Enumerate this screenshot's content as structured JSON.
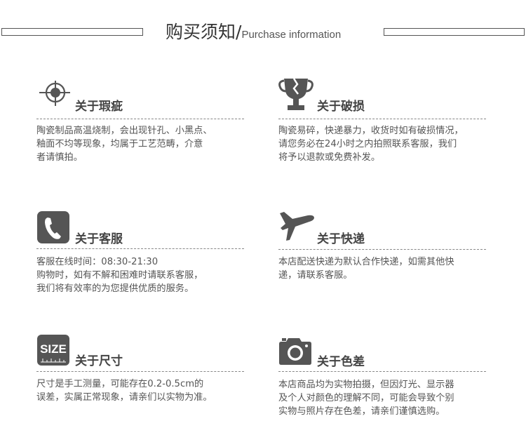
{
  "header": {
    "title_zh": "购买须知",
    "separator": "/",
    "title_en": "Purchase information"
  },
  "sections": [
    {
      "icon": "crosshair-icon",
      "title": "关于瑕疵",
      "text": "陶瓷制品高温烧制，会出现针孔、小黑点、\n釉面不均等现象，均属于工艺范畴，介意\n者请慎拍。"
    },
    {
      "icon": "broken-trophy-icon",
      "title": "关于破损",
      "text": "陶瓷易碎，快递暴力，收货时如有破损情况，\n请您务必在24小时之内拍照联系客服，我们\n将予以退款或免费补发。"
    },
    {
      "icon": "phone-icon",
      "title": "关于客服",
      "text": "客服在线时间：08:30-21:30\n购物时，如有不解和困难时请联系客服，\n我们将有效率的为您提供优质的服务。"
    },
    {
      "icon": "airplane-icon",
      "title": "关于快递",
      "text": "本店配送快递为默认合作快递，如需其他快\n递，请联系客服。"
    },
    {
      "icon": "size-ruler-icon",
      "icon_text": "SIZE",
      "title": "关于尺寸",
      "text": "尺寸是手工测量，可能存在0.2-0.5cm的\n误差，实属正常现象，请亲们以实物为准。"
    },
    {
      "icon": "camera-icon",
      "title": "关于色差",
      "text": "本店商品均为实物拍摄，但因灯光、显示器\n及个人对颜色的理解不同，可能会导致个别\n实物与照片存在色差，请亲们谨慎选购。"
    }
  ]
}
